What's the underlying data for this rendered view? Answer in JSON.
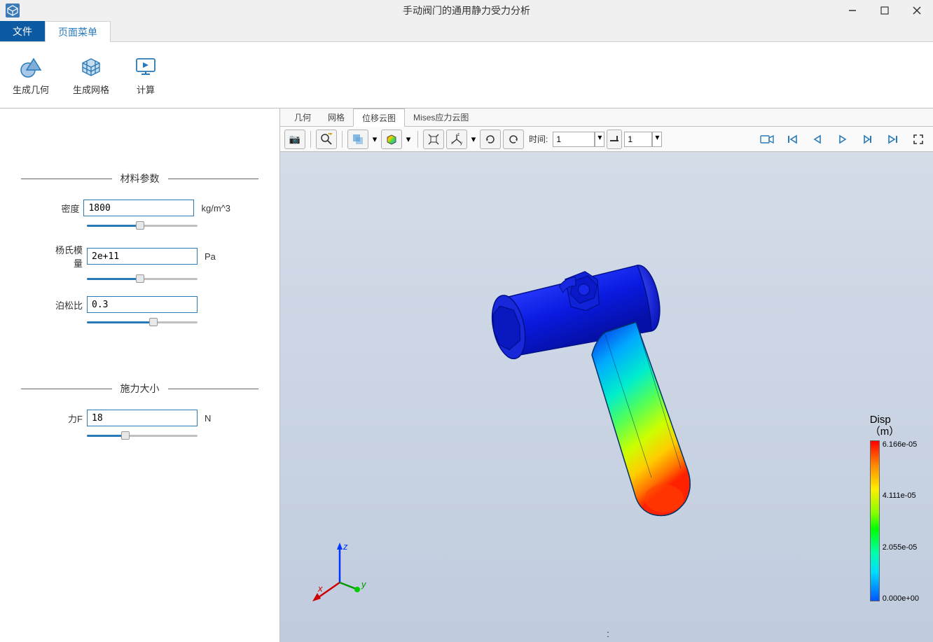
{
  "window": {
    "title": "手动阀门的通用静力受力分析"
  },
  "menu": {
    "file": "文件",
    "page_menu": "页面菜单"
  },
  "ribbon": {
    "build_geometry": "生成几何",
    "build_mesh": "生成网格",
    "compute": "计算"
  },
  "sections": {
    "material": "材料参数",
    "force": "施力大小"
  },
  "params": {
    "density": {
      "label": "密度",
      "value": "1800",
      "unit": "kg/m^3",
      "slider_pct": 48
    },
    "youngs": {
      "label": "杨氏模量",
      "value": "2e+11",
      "unit": "Pa",
      "slider_pct": 48
    },
    "poisson": {
      "label": "泊松比",
      "value": "0.3",
      "unit": "",
      "slider_pct": 60
    },
    "forceF": {
      "label": "力F",
      "value": "18",
      "unit": "N",
      "slider_pct": 35
    }
  },
  "view_tabs": {
    "geometry": "几何",
    "mesh": "网格",
    "disp_plot": "位移云图",
    "mises_plot": "Mises应力云图"
  },
  "toolbar": {
    "time_label": "时间:",
    "time_value": "1",
    "frame_value": "1"
  },
  "legend": {
    "title1": "Disp",
    "title2": "（m）",
    "max": "6.166e-05",
    "mid2": "4.111e-05",
    "mid1": "2.055e-05",
    "min": "0.000e+00"
  },
  "triad": {
    "x": "x",
    "y": "y",
    "z": "z"
  },
  "status": {
    "colon": ":"
  }
}
